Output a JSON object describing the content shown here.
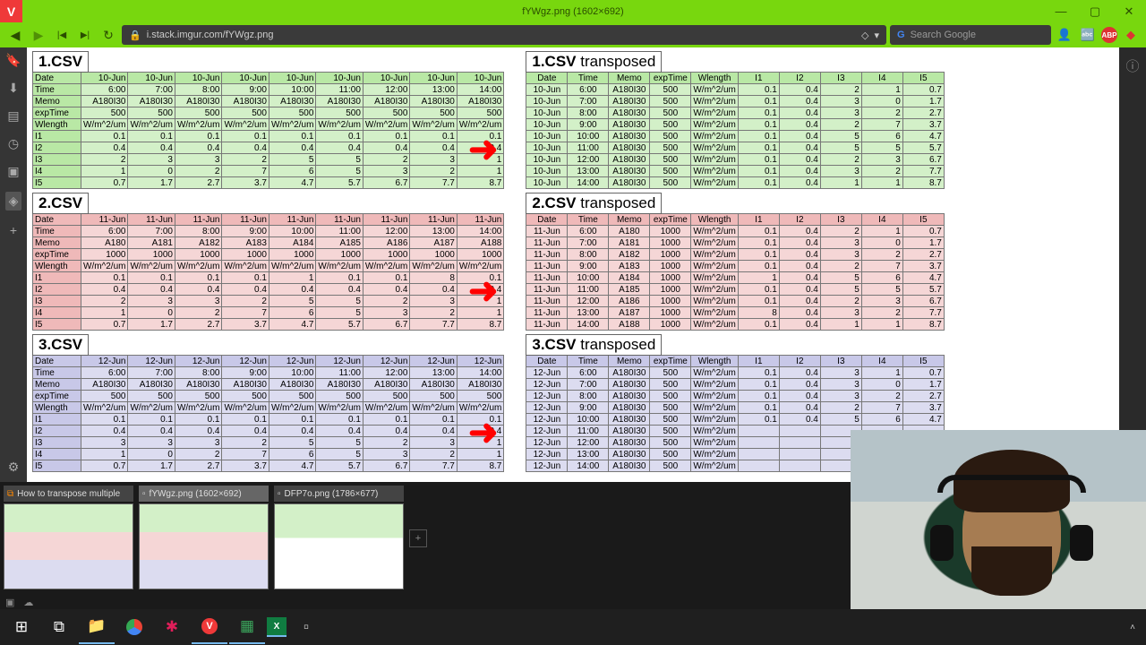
{
  "window": {
    "title": "fYWgz.png (1602×692)"
  },
  "address": {
    "url": "i.stack.imgur.com/fYWgz.png"
  },
  "search": {
    "placeholder": "Search Google"
  },
  "tabs": [
    {
      "label": "How to transpose multiple",
      "active": false
    },
    {
      "label": "fYWgz.png (1602×692)",
      "active": true
    },
    {
      "label": "DFP7o.png (1786×677)",
      "active": false
    }
  ],
  "csv_row_labels": [
    "Date",
    "Time",
    "Memo",
    "expTime",
    "Wlength",
    "I1",
    "I2",
    "I3",
    "I4",
    "I5"
  ],
  "transposed_headers": [
    "Date",
    "Time",
    "Memo",
    "expTime",
    "Wlength",
    "I1",
    "I2",
    "I3",
    "I4",
    "I5"
  ],
  "times": [
    "6:00",
    "7:00",
    "8:00",
    "9:00",
    "10:00",
    "11:00",
    "12:00",
    "13:00",
    "14:00"
  ],
  "groups": [
    {
      "id": "1",
      "title": "1.CSV",
      "t_title": "1.CSV transposed",
      "date": "10-Jun",
      "memo": "A180I30",
      "expTime": "500",
      "wlength": "W/m^2/um",
      "I1": [
        "0.1",
        "0.1",
        "0.1",
        "0.1",
        "0.1",
        "0.1",
        "0.1",
        "0.1",
        "0.1"
      ],
      "I2": [
        "0.4",
        "0.4",
        "0.4",
        "0.4",
        "0.4",
        "0.4",
        "0.4",
        "0.4",
        "0.4"
      ],
      "I3": [
        "2",
        "3",
        "3",
        "2",
        "5",
        "5",
        "2",
        "3",
        "1"
      ],
      "I4": [
        "1",
        "0",
        "2",
        "7",
        "6",
        "5",
        "3",
        "2",
        "1"
      ],
      "I5": [
        "0.7",
        "1.7",
        "2.7",
        "3.7",
        "4.7",
        "5.7",
        "6.7",
        "7.7",
        "8.7"
      ]
    },
    {
      "id": "2",
      "title": "2.CSV",
      "t_title": "2.CSV transposed",
      "date": "11-Jun",
      "memo_series": [
        "A180",
        "A181",
        "A182",
        "A183",
        "A184",
        "A185",
        "A186",
        "A187",
        "A188"
      ],
      "expTime": "1000",
      "wlength": "W/m^2/um",
      "I1": [
        "0.1",
        "0.1",
        "0.1",
        "0.1",
        "1",
        "0.1",
        "0.1",
        "8",
        "0.1"
      ],
      "I2": [
        "0.4",
        "0.4",
        "0.4",
        "0.4",
        "0.4",
        "0.4",
        "0.4",
        "0.4",
        "0.4"
      ],
      "I3": [
        "2",
        "3",
        "3",
        "2",
        "5",
        "5",
        "2",
        "3",
        "1"
      ],
      "I4": [
        "1",
        "0",
        "2",
        "7",
        "6",
        "5",
        "3",
        "2",
        "1"
      ],
      "I5": [
        "0.7",
        "1.7",
        "2.7",
        "3.7",
        "4.7",
        "5.7",
        "6.7",
        "7.7",
        "8.7"
      ]
    },
    {
      "id": "3",
      "title": "3.CSV",
      "t_title": "3.CSV transposed",
      "date": "12-Jun",
      "memo": "A180I30",
      "expTime": "500",
      "wlength": "W/m^2/um",
      "I1": [
        "0.1",
        "0.1",
        "0.1",
        "0.1",
        "0.1",
        "0.1",
        "0.1",
        "0.1",
        "0.1"
      ],
      "I2": [
        "0.4",
        "0.4",
        "0.4",
        "0.4",
        "0.4",
        "0.4",
        "0.4",
        "0.4",
        "0.4"
      ],
      "I3": [
        "3",
        "3",
        "3",
        "2",
        "5",
        "5",
        "2",
        "3",
        "1"
      ],
      "I4": [
        "1",
        "0",
        "2",
        "7",
        "6",
        "5",
        "3",
        "2",
        "1"
      ],
      "I5": [
        "0.7",
        "1.7",
        "2.7",
        "3.7",
        "4.7",
        "5.7",
        "6.7",
        "7.7",
        "8.7"
      ]
    }
  ]
}
